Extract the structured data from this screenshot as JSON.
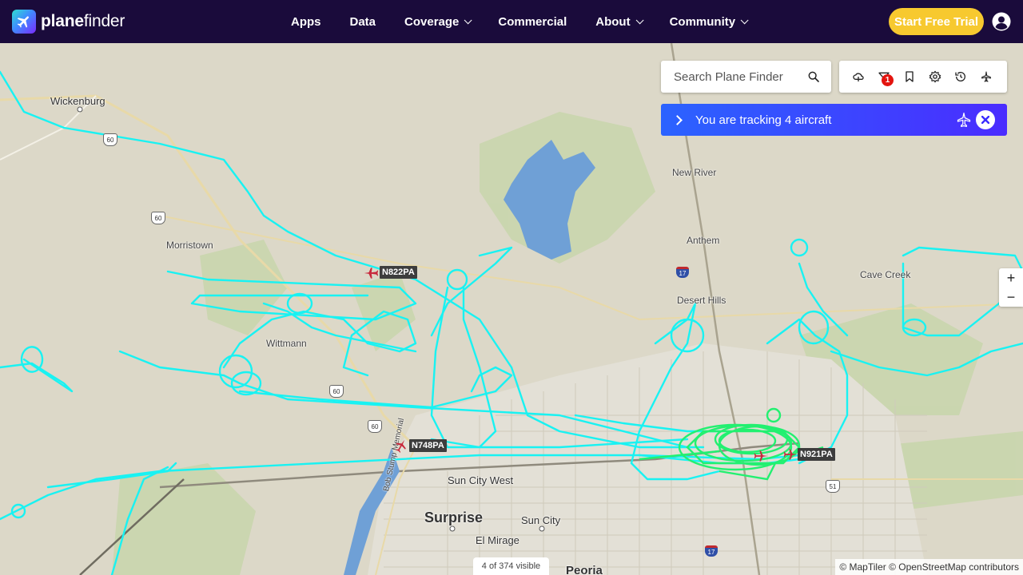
{
  "header": {
    "logo": {
      "bold": "plane",
      "light": "finder"
    },
    "nav": [
      {
        "label": "Apps",
        "has_menu": false
      },
      {
        "label": "Data",
        "has_menu": false
      },
      {
        "label": "Coverage",
        "has_menu": true
      },
      {
        "label": "Commercial",
        "has_menu": false
      },
      {
        "label": "About",
        "has_menu": true
      },
      {
        "label": "Community",
        "has_menu": true
      }
    ],
    "cta_label": "Start Free Trial",
    "colors": {
      "bar": "#1a0b3b",
      "cta": "#f7c92f"
    }
  },
  "search": {
    "placeholder": "Search Plane Finder"
  },
  "toolbar": {
    "icons": [
      "weather-cloud-icon",
      "filter-icon",
      "bookmark-icon",
      "settings-gear-icon",
      "history-icon",
      "airport-icon"
    ],
    "filter_badge": "1"
  },
  "tracking": {
    "label": "You are tracking 4 aircraft"
  },
  "zoom": {
    "in": "+",
    "out": "−"
  },
  "map": {
    "places": [
      "Wickenburg",
      "Morristown",
      "Wittmann",
      "New River",
      "Anthem",
      "Desert Hills",
      "Cave Creek",
      "Sun City West",
      "Surprise",
      "Sun City",
      "El Mirage",
      "Peoria",
      "Bob Stump Memorial"
    ],
    "route_shields": [
      "60",
      "60",
      "60",
      "60",
      "51"
    ],
    "interstate_shields": [
      "17",
      "17"
    ],
    "aircraft": [
      "N822PA",
      "N748PA",
      "N921PA"
    ],
    "track_color": "#19f2f2",
    "active_track_color": "#22f070"
  },
  "footer": {
    "visible_count": "4 of 374 visible",
    "attribution": "© MapTiler © OpenStreetMap contributors"
  }
}
